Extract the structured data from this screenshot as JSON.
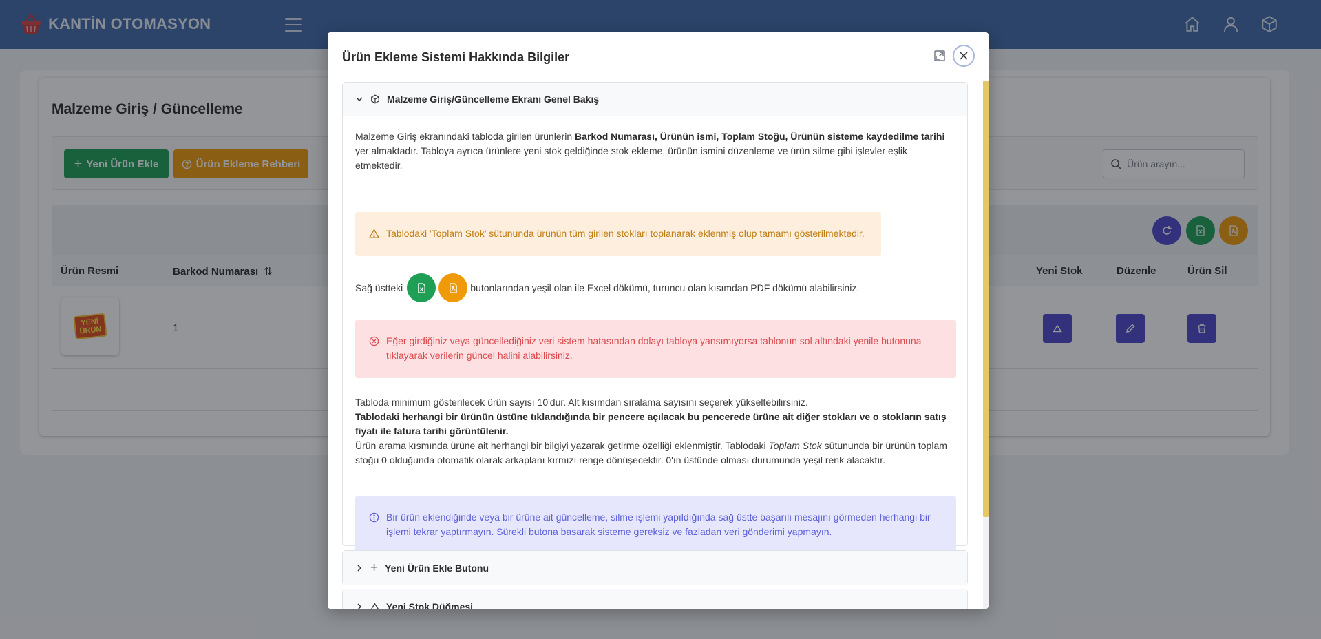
{
  "app": {
    "title": "KANTİN OTOMASYON"
  },
  "page": {
    "title": "Malzeme Giriş / Güncelleme",
    "new_product_button": "Yeni Ürün Ekle",
    "guide_button": "Ürün Ekleme Rehberi",
    "search_placeholder": "Ürün arayın..."
  },
  "table": {
    "columns": [
      "Ürün Resmi",
      "Barkod Numarası",
      "Yeni Stok",
      "Düzenle",
      "Ürün Sil"
    ],
    "rows": [
      {
        "image_text_1": "YENİ",
        "image_text_2": "ÜRÜN",
        "barcode": "1"
      }
    ]
  },
  "modal": {
    "title": "Ürün Ekleme Sistemi Hakkında Bilgiler",
    "accordion": [
      {
        "title": "Malzeme Giriş/Güncelleme Ekranı Genel Bakış",
        "expanded": true
      },
      {
        "title": "Yeni Ürün Ekle Butonu",
        "expanded": false
      },
      {
        "title": "Yeni Stok Düğmesi",
        "expanded": false
      }
    ],
    "section1": {
      "p1_a": "Malzeme Giriş ekranındaki tabloda girilen ürünlerin ",
      "p1_b": "Barkod Numarası, Ürünün ismi, Toplam Stoğu, Ürünün sisteme kaydedilme tarihi",
      "p1_c": " yer almaktadır. Tabloya ayrıca ürünlere yeni stok geldiğinde stok ekleme, ürünün ismini düzenleme ve ürün silme gibi işlevler eşlik etmektedir.",
      "warning": "Tablodaki 'Toplam Stok' sütununda ürünün tüm girilen stokları toplanarak eklenmiş olup tamamı gösterilmektedir.",
      "export_a": "Sağ üstteki",
      "export_b": "butonlarından yeşil olan ile Excel dökümü, turuncu olan kısımdan PDF dökümü alabilirsiniz.",
      "danger": "Eğer girdiğiniz veya güncellediğiniz veri sistem hatasından dolayı tabloya yansımıyorsa tablonun sol altındaki yenile butonuna tıklayarak verilerin güncel halini alabilirsiniz.",
      "p3_a": "Tabloda minimum gösterilecek ürün sayısı 10'dur. Alt kısımdan sıralama sayısını seçerek yükseltebilirsiniz.",
      "p3_b": "Tablodaki herhangi bir ürünün üstüne tıklandığında bir pencere açılacak bu pencerede ürüne ait diğer stokları ve o stokların satış fiyatı ile fatura tarihi görüntülenir.",
      "p3_c": "Ürün arama kısmında ürüne ait herhangi bir bilgiyi yazarak getirme özelliği eklenmiştir. Tablodaki ",
      "p3_d": "Toplam Stok",
      "p3_e": " sütununda bir ürünün toplam stoğu 0 olduğunda otomatik olarak arkaplanı kırmızı renge dönüşecektir. 0'ın üstünde olması durumunda yeşil renk alacaktır.",
      "info": "Bir ürün eklendiğinde veya bir ürüne ait güncelleme, silme işlemi yapıldığında sağ üstte başarılı mesajını görmeden herhangi bir işlemi tekrar yaptırmayın. Sürekli butona basarak sisteme gereksiz ve fazladan veri gönderimi yapmayın."
    }
  },
  "colors": {
    "topbar": "#4169a8",
    "green": "#1e9f55",
    "orange": "#ef9a09",
    "indigo": "#4e46c8"
  }
}
